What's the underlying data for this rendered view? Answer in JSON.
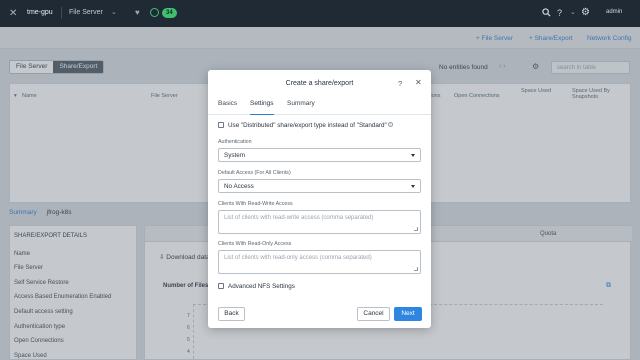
{
  "topbar": {
    "cluster_name": "tme-gpu",
    "app_name": "File Server",
    "alert_count": "34",
    "help_label": "?",
    "user": "admin",
    "status_color": "#3fbf6f"
  },
  "subheader": {
    "links": [
      "+ File Server",
      "+ Share/Export",
      "Network Config"
    ]
  },
  "view_toggle": [
    "File Server",
    "Share/Export"
  ],
  "list": {
    "entities_label": "No entities found",
    "search_placeholder": "search in table",
    "columns": [
      "Name",
      "File Server",
      "Max Connections",
      "Open Connections",
      "Space Used",
      "Space Used By Snapshots"
    ]
  },
  "breadcrumb": {
    "root": "Summary",
    "current": "jfrog-k8s"
  },
  "details": {
    "title": "SHARE/EXPORT DETAILS",
    "rows": [
      "Name",
      "File Server",
      "Self Service Restore",
      "Access Based Enumeration Enabled",
      "Default access setting",
      "Authentication type",
      "Open Connections",
      "Space Used"
    ]
  },
  "right_panel": {
    "tab_quota": "Quota",
    "download_label": "Download data",
    "chart_title": "Number of Files",
    "y_ticks": [
      "7",
      "6",
      "5",
      "4",
      "3"
    ]
  },
  "modal": {
    "title": "Create a share/export",
    "help_label": "?",
    "close_label": "✕",
    "tabs": [
      "Basics",
      "Settings",
      "Summary"
    ],
    "active_tab": "Settings",
    "distributed_label": "Use \"Distributed\" share/export type instead of \"Standard\"",
    "authentication": {
      "label": "Authentication",
      "value": "System"
    },
    "default_access": {
      "label": "Default Access (For All Clients)",
      "value": "No Access"
    },
    "rw_clients": {
      "label": "Clients With Read-Write Access",
      "placeholder": "List of clients with read-write access (comma separated)"
    },
    "ro_clients": {
      "label": "Clients With Read-Only Access",
      "placeholder": "List of clients with read-only access (comma separated)"
    },
    "advanced_nfs_label": "Advanced NFS Settings",
    "buttons": {
      "back": "Back",
      "cancel": "Cancel",
      "next": "Next"
    },
    "accent_color": "#2f86e0"
  }
}
